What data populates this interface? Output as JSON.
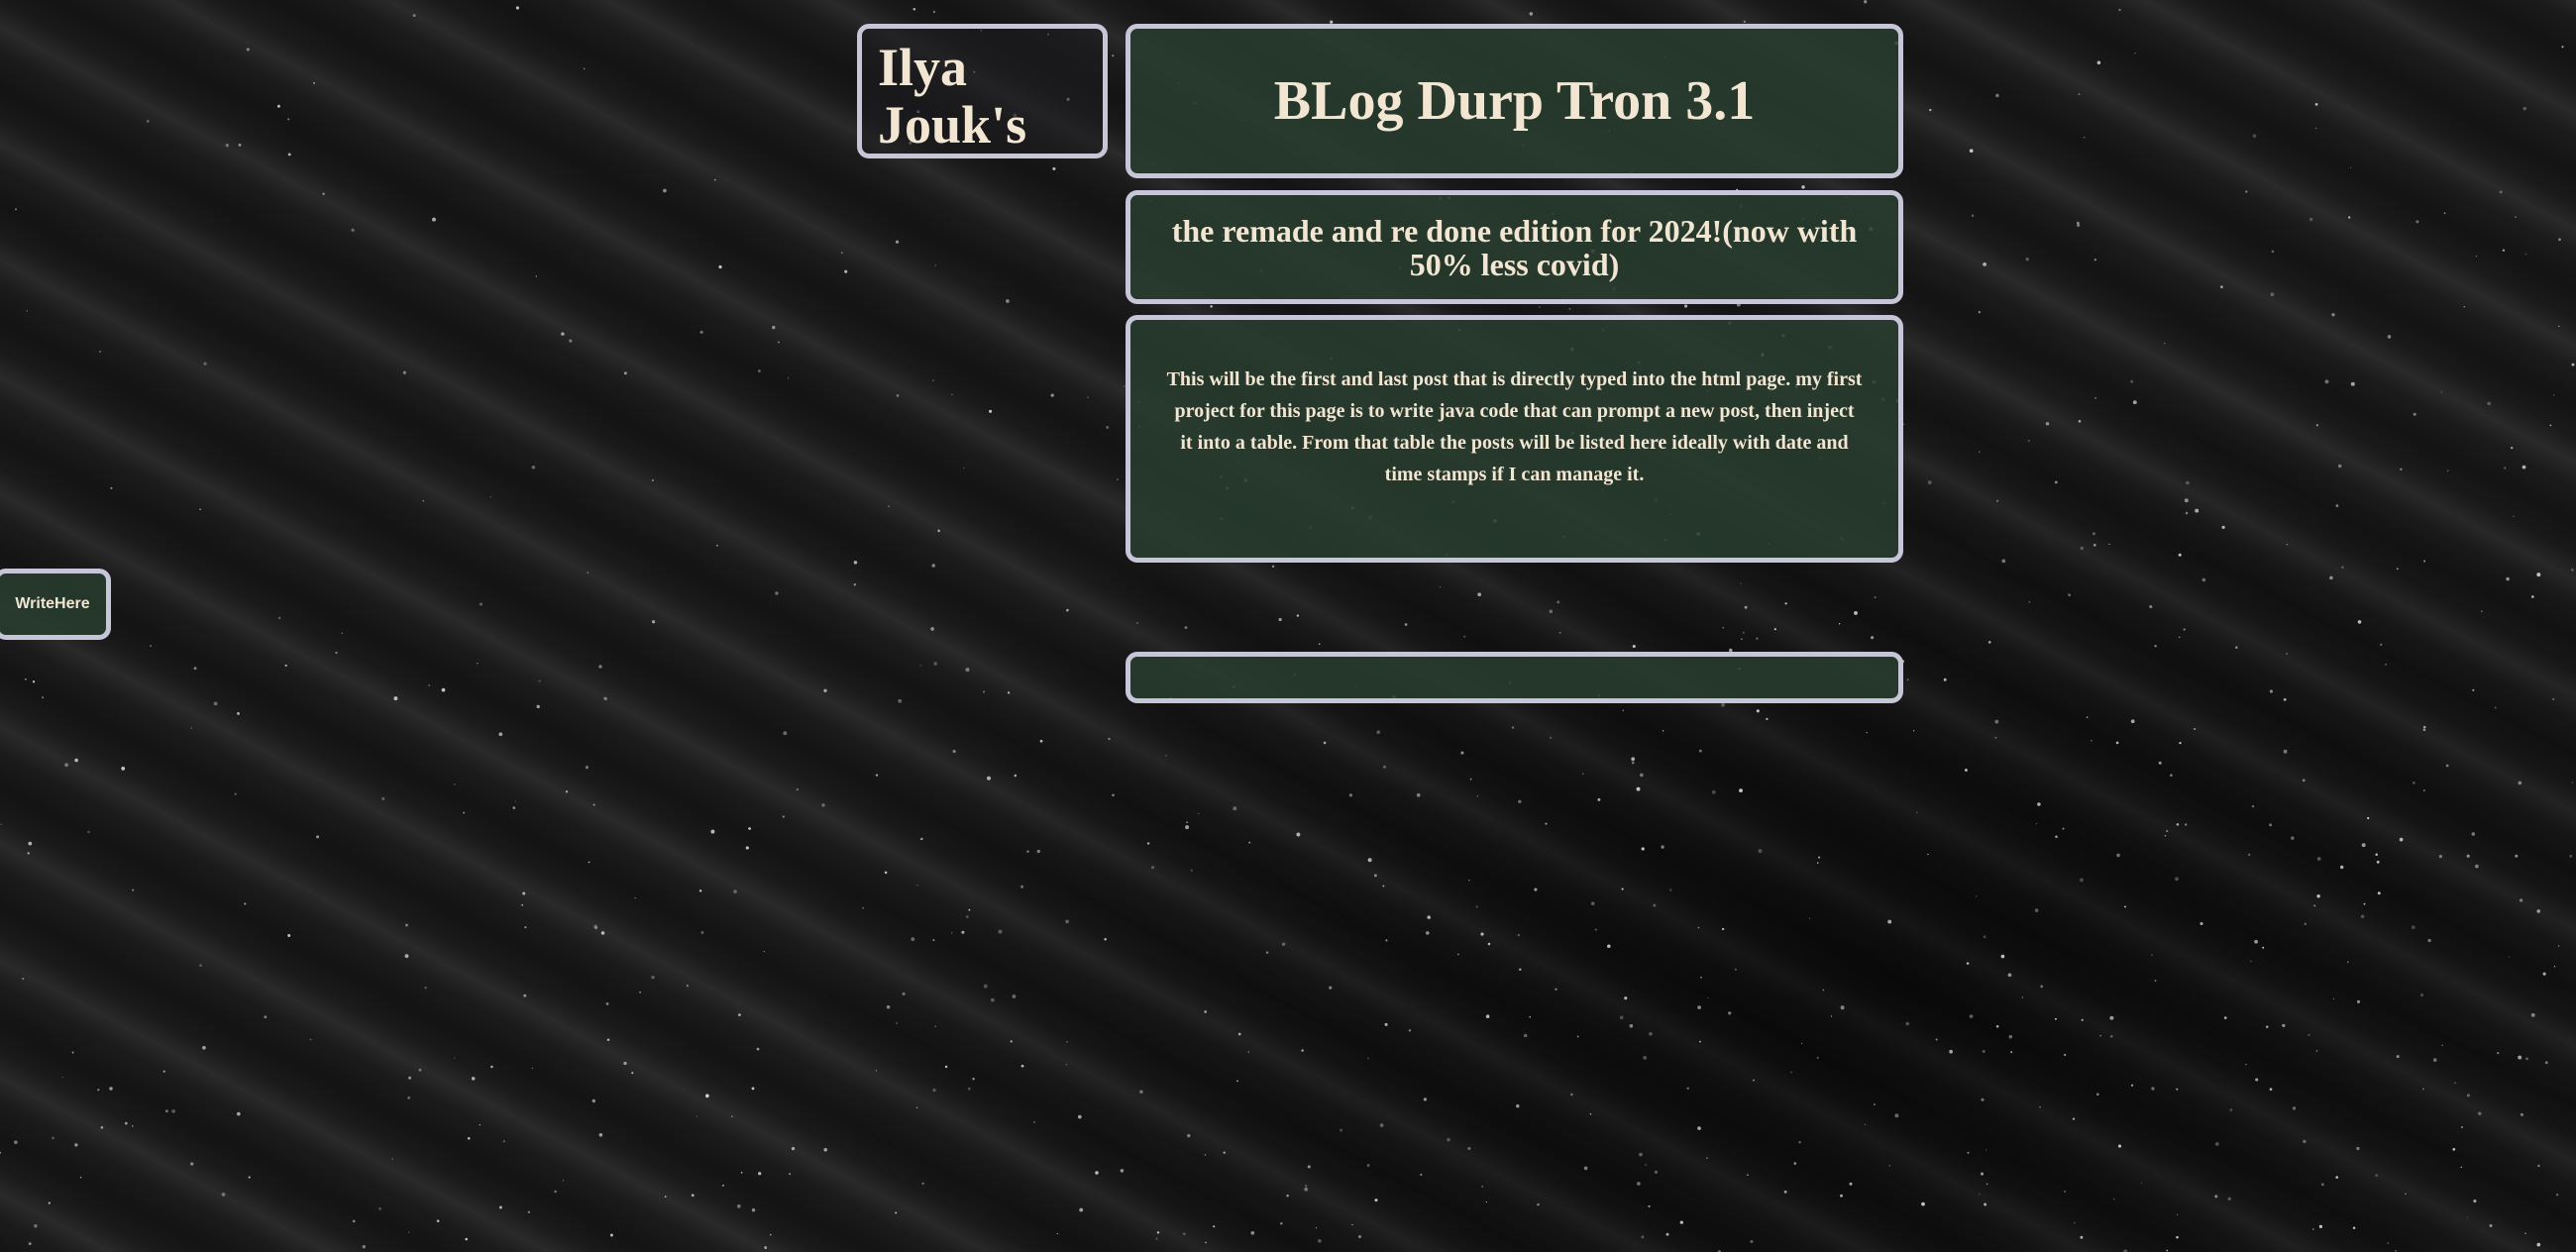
{
  "header": {
    "name_line1": "Ilya",
    "name_line2": "Jouk's",
    "title": "BLog Durp Tron 3.1",
    "subtitle": "the remade and re done edition for 2024!(now with 50% less covid)"
  },
  "post": {
    "body": "This will be the first and last post that is directly typed into the html page. my first project for this page is to write java code that can prompt a new post, then inject it into a table. From that table the posts will be listed here ideally with date and time stamps if I can manage it."
  },
  "controls": {
    "write_button_label": "WriteHere"
  },
  "colors": {
    "panel_bg": "#283e2e",
    "panel_border": "#c6c6d8",
    "text": "#f2e6d2",
    "page_bg": "#161616"
  }
}
